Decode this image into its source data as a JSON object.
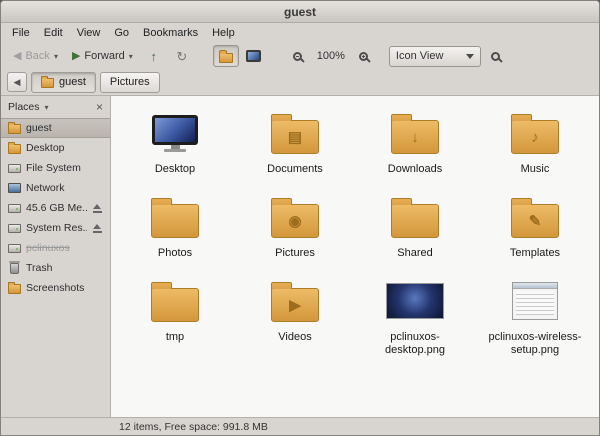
{
  "window": {
    "title": "guest"
  },
  "menubar": {
    "items": [
      "File",
      "Edit",
      "View",
      "Go",
      "Bookmarks",
      "Help"
    ]
  },
  "toolbar": {
    "back_label": "Back",
    "forward_label": "Forward",
    "zoom_level": "100%",
    "view_mode": "Icon View",
    "icons": {
      "back": "◀",
      "forward": "▶",
      "up": "↑",
      "refresh": "↻",
      "dropdown": "▾"
    }
  },
  "pathbar": {
    "back_icon": "◀",
    "buttons": [
      {
        "label": "guest",
        "active": true
      },
      {
        "label": "Pictures",
        "active": false
      }
    ]
  },
  "sidebar": {
    "header": "Places",
    "collapse_icon": "▾",
    "close_icon": "×",
    "items": [
      {
        "label": "guest",
        "icon": "folder",
        "selected": true
      },
      {
        "label": "Desktop",
        "icon": "folder"
      },
      {
        "label": "File System",
        "icon": "drive"
      },
      {
        "label": "Network",
        "icon": "network"
      },
      {
        "label": "45.6 GB Me...",
        "icon": "drive",
        "eject": true
      },
      {
        "label": "System Res...",
        "icon": "drive",
        "eject": true
      },
      {
        "label": "pclinuxos",
        "icon": "drive",
        "disabled": true
      },
      {
        "label": "Trash",
        "icon": "trash"
      },
      {
        "label": "Screenshots",
        "icon": "folder"
      }
    ]
  },
  "files": [
    {
      "name": "Desktop",
      "kind": "desktop",
      "emblem": ""
    },
    {
      "name": "Documents",
      "kind": "folder",
      "emblem": "▤"
    },
    {
      "name": "Downloads",
      "kind": "folder",
      "emblem": "↓"
    },
    {
      "name": "Music",
      "kind": "folder",
      "emblem": "♪"
    },
    {
      "name": "Photos",
      "kind": "folder",
      "emblem": ""
    },
    {
      "name": "Pictures",
      "kind": "folder",
      "emblem": "◉"
    },
    {
      "name": "Shared",
      "kind": "folder",
      "emblem": ""
    },
    {
      "name": "Templates",
      "kind": "folder",
      "emblem": "✎"
    },
    {
      "name": "tmp",
      "kind": "folder",
      "emblem": ""
    },
    {
      "name": "Videos",
      "kind": "folder",
      "emblem": "▶"
    },
    {
      "name": "pclinuxos-desktop.png",
      "kind": "image-desktop",
      "emblem": ""
    },
    {
      "name": "pclinuxos-wireless-setup.png",
      "kind": "image-window",
      "emblem": ""
    }
  ],
  "statusbar": {
    "text": "12 items, Free space: 991.8 MB"
  }
}
